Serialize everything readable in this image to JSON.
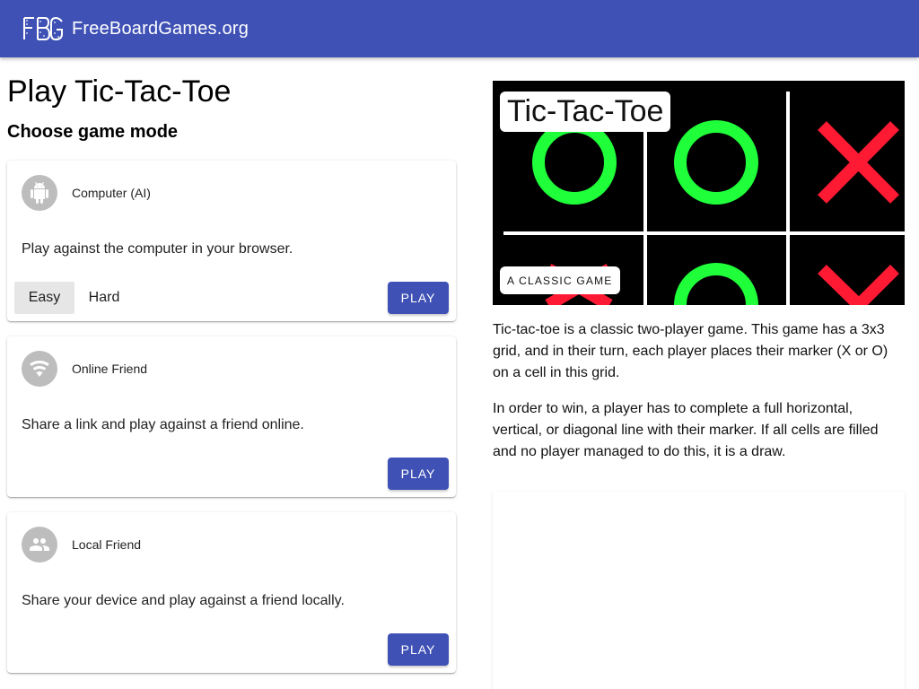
{
  "header": {
    "brand": "FreeBoardGames.org",
    "logo_icon": "fbg-logo-icon",
    "bar_color": "#3f51b5"
  },
  "page": {
    "title": "Play Tic-Tac-Toe",
    "subtitle": "Choose game mode"
  },
  "modes": [
    {
      "icon": "android-icon",
      "name": "Computer (AI)",
      "description": "Play against the computer in your browser.",
      "difficulties": [
        "Easy",
        "Hard"
      ],
      "selected_difficulty": "Easy",
      "play_label": "PLAY"
    },
    {
      "icon": "wifi-icon",
      "name": "Online Friend",
      "description": "Share a link and play against a friend online.",
      "play_label": "PLAY"
    },
    {
      "icon": "people-icon",
      "name": "Local Friend",
      "description": "Share your device and play against a friend locally.",
      "play_label": "PLAY"
    }
  ],
  "hero": {
    "title": "Tic-Tac-Toe",
    "badge": "A CLASSIC GAME",
    "o_color": "#1fff3a",
    "x_color": "#ff1a33"
  },
  "description": [
    "Tic-tac-toe is a classic two-player game. This game has a 3x3 grid, and in their turn, each player places their marker (X or O) on a cell in this grid.",
    "In order to win, a player has to complete a full horizontal, vertical, or diagonal line with their marker. If all cells are filled and no player managed to do this, it is a draw."
  ]
}
